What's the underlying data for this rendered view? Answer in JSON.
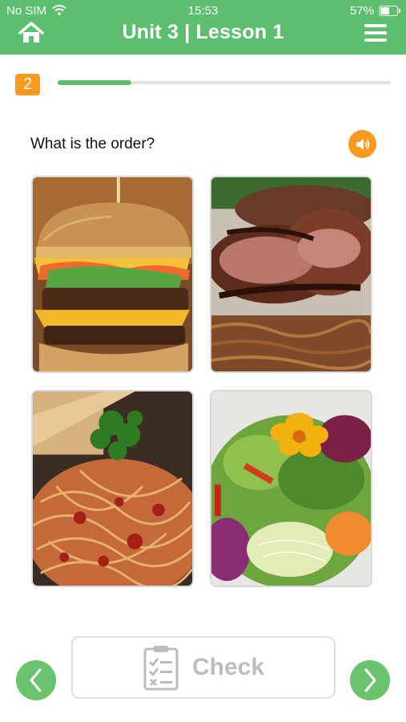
{
  "status_bar": {
    "carrier": "No SIM",
    "time": "15:53",
    "battery": "57%"
  },
  "header": {
    "title": "Unit 3 | Lesson 1",
    "home_icon": "home-icon",
    "menu_icon": "hamburger-menu-icon"
  },
  "progress": {
    "step": "2",
    "fraction": 0.22
  },
  "question": {
    "text": "What is the order?",
    "audio_icon": "speaker-icon"
  },
  "options": [
    {
      "name": "burger",
      "icon": "burger-image"
    },
    {
      "name": "grilled-meat",
      "icon": "grilled-meat-image"
    },
    {
      "name": "spaghetti",
      "icon": "spaghetti-image"
    },
    {
      "name": "salad",
      "icon": "salad-image"
    }
  ],
  "footer": {
    "check_label": "Check",
    "prev_icon": "chevron-left-icon",
    "next_icon": "chevron-right-icon"
  },
  "colors": {
    "brand_green": "#5cbf6f",
    "accent_orange": "#f79a1f"
  }
}
